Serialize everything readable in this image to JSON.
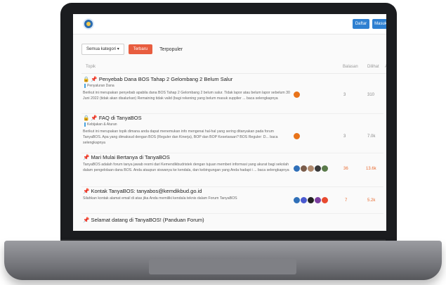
{
  "header": {
    "btn1": "Daftar",
    "btn2": "Masuk"
  },
  "filters": {
    "select_value": "Semua kategori",
    "tab_active": "Terbaru",
    "tab": "Terpopuler"
  },
  "table": {
    "col_topic": "Topik",
    "col_replies": "Balasan",
    "col_views": "Dilihat",
    "col_activity": "A"
  },
  "rows": [
    {
      "title": "Penyebab Dana BOS Tahap 2 Gelombang 2 Belum Salur",
      "category": "Penyaluran Dana",
      "excerpt": "Berikut ini merupakan penyebab apabila dana BOS Tahap 2 Gelombang 2 belum salur. Tidak lapor atau belum lapor sebelum 30 Juni 2022 (tidak akan disalurkan) Remaining tidak valid (bagi rekening yang belum masuk supplier ... baca selengkapnya",
      "replies": "3",
      "views": "310"
    },
    {
      "title": "FAQ di TanyaBOS",
      "category": "Kebijakan & Aturan",
      "excerpt": "Berikut ini merupakan topik dimana anda dapat menemukan info mengenai hal-hal yang sering ditanyakan pada forum TanyaBOS. Apa yang dimaksud dengan BOS (Reguler dan Kinerja), BOP dan BOP Kesetaraan? BOS Reguler: D... baca selengkapnya",
      "replies": "3",
      "views": "7.0k"
    },
    {
      "title": "Mari Mulai Bertanya di TanyaBOS",
      "category": "",
      "excerpt": "TanyaBOS adalah forum tanya jawab resmi dari Kemendikbudristek dengan tujuan memberi informasi yang akurat bagi sekolah dalam pengelolaan dana BOS. Anda ataupun siswanya ke kendala, dan kebingungan yang Anda hadapi i ... baca selengkapnya",
      "replies": "36",
      "views": "13.6k"
    },
    {
      "title": "Kontak TanyaBOS: tanyabos@kemdikbud.go.id",
      "category": "",
      "excerpt": "Silahkan kontak alamat email di atas jika Anda memiliki kendala teknis dalam Forum TanyaBOS",
      "replies": "7",
      "views": "5.2k"
    },
    {
      "title": "Selamat datang di TanyaBOS! (Panduan Forum)",
      "category": "",
      "excerpt": "",
      "replies": "",
      "views": ""
    }
  ],
  "colors": {
    "accent": "#e85d3f",
    "primary": "#2f80d1",
    "bezel": "#1b1c1f",
    "body": "#7f8085"
  }
}
